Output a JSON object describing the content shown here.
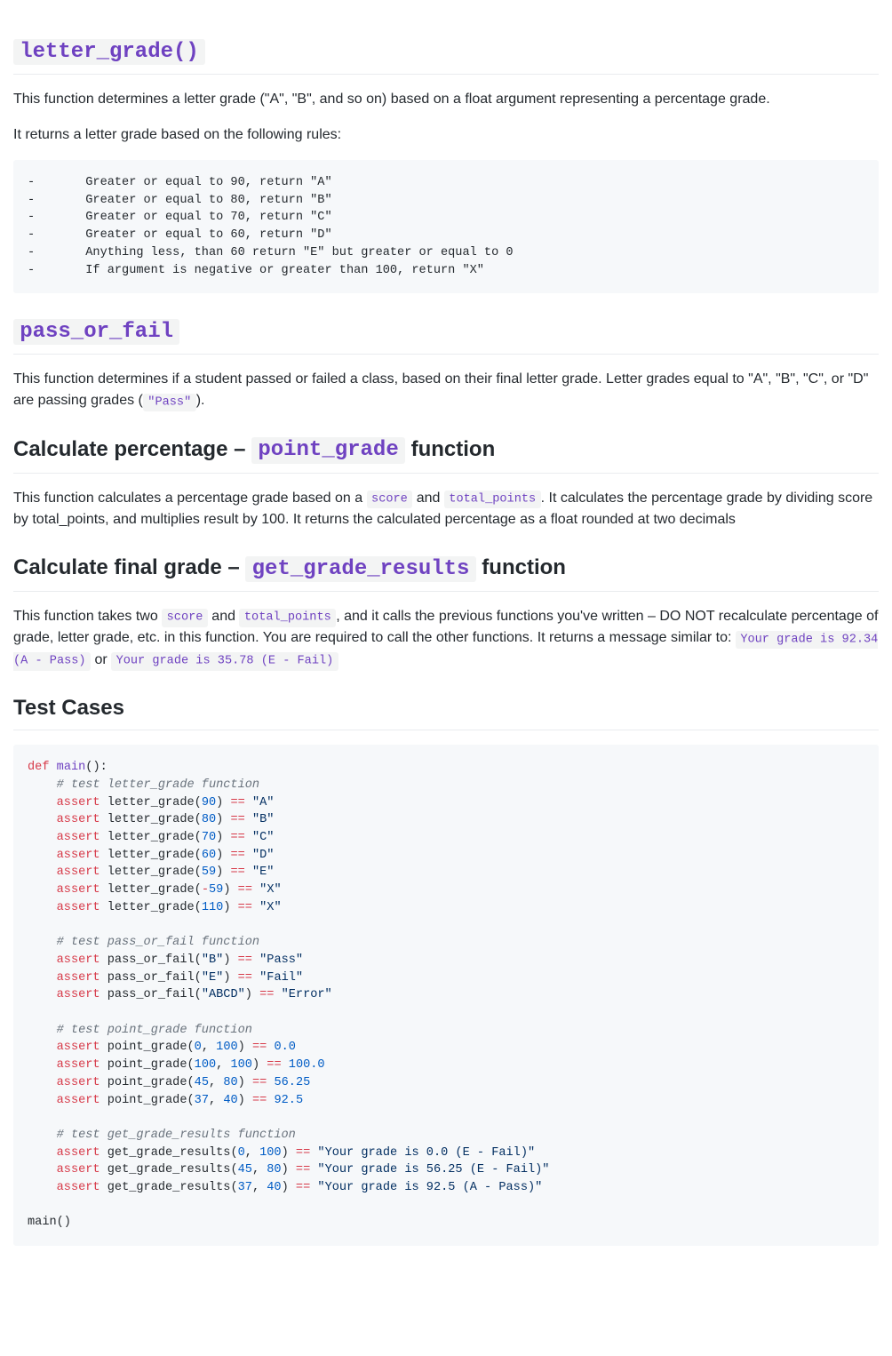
{
  "sections": {
    "letter_grade": {
      "title_code": "letter_grade()",
      "p1": "This function determines a letter grade (\"A\", \"B\", and so on) based on a float argument representing a percentage grade.",
      "p2": "It returns a letter grade based on the following rules:",
      "rules_block": "-\tGreater or equal to 90, return \"A\"\n-\tGreater or equal to 80, return \"B\"\n-\tGreater or equal to 70, return \"C\"\n-\tGreater or equal to 60, return \"D\"\n-\tAnything less, than 60 return \"E\" but greater or equal to 0\n-\tIf argument is negative or greater than 100, return \"X\""
    },
    "pass_or_fail": {
      "title_code": "pass_or_fail",
      "p1_a": "This function determines if a student passed or failed a class, based on their final letter grade. Letter grades equal to \"A\", \"B\", \"C\", or \"D\" are passing grades (",
      "p1_code": "\"Pass\"",
      "p1_b": ")."
    },
    "point_grade": {
      "title_pre": "Calculate percentage – ",
      "title_code": "point_grade",
      "title_post": " function",
      "p1_a": "This function calculates a percentage grade based on a ",
      "p1_code1": "score",
      "p1_b": " and ",
      "p1_code2": "total_points",
      "p1_c": ". It calculates the percentage grade by dividing score by total_points, and multiplies result by 100. It returns the calculated percentage as a float rounded at two decimals"
    },
    "get_grade_results": {
      "title_pre": "Calculate final grade – ",
      "title_code": "get_grade_results",
      "title_post": " function",
      "p1_a": "This function takes two ",
      "p1_code1": "score",
      "p1_b": " and ",
      "p1_code2": "total_points",
      "p1_c": ", and it calls the previous functions you've written – DO NOT recalculate percentage of grade, letter grade, etc. in this function. You are required to call the other functions. It returns a message similar to: ",
      "p1_code3": "Your grade is 92.34 (A - Pass)",
      "p1_d": " or ",
      "p1_code4": "Your grade is 35.78 (E - Fail)"
    },
    "test_cases": {
      "title": "Test Cases"
    }
  },
  "code": {
    "kw_def": "def",
    "kw_assert": "assert",
    "main_sig": "main():",
    "c1": "# test letter_grade function",
    "c2": "# test pass_or_fail function",
    "c3": "# test point_grade function",
    "c4": "# test get_grade_results function",
    "lg_calls": [
      {
        "arg": "90",
        "res": "\"A\""
      },
      {
        "arg": "80",
        "res": "\"B\""
      },
      {
        "arg": "70",
        "res": "\"C\""
      },
      {
        "arg": "60",
        "res": "\"D\""
      },
      {
        "arg": "59",
        "res": "\"E\""
      },
      {
        "arg_pre": "-",
        "arg": "59",
        "res": "\"X\""
      },
      {
        "arg": "110",
        "res": "\"X\""
      }
    ],
    "pf_calls": [
      {
        "arg": "\"B\"",
        "res": "\"Pass\""
      },
      {
        "arg": "\"E\"",
        "res": "\"Fail\""
      },
      {
        "arg": "\"ABCD\"",
        "res": "\"Error\""
      }
    ],
    "pg_calls": [
      {
        "a1": "0",
        "a2": "100",
        "res": "0.0"
      },
      {
        "a1": "100",
        "a2": "100",
        "res": "100.0"
      },
      {
        "a1": "45",
        "a2": "80",
        "res": "56.25"
      },
      {
        "a1": "37",
        "a2": "40",
        "res": "92.5"
      }
    ],
    "ggr_calls": [
      {
        "a1": "0",
        "a2": "100",
        "res": "\"Your grade is 0.0 (E - Fail)\""
      },
      {
        "a1": "45",
        "a2": "80",
        "res": "\"Your grade is 56.25 (E - Fail)\""
      },
      {
        "a1": "37",
        "a2": "40",
        "res": "\"Your grade is 92.5 (A - Pass)\""
      }
    ],
    "call_main": "main()"
  }
}
